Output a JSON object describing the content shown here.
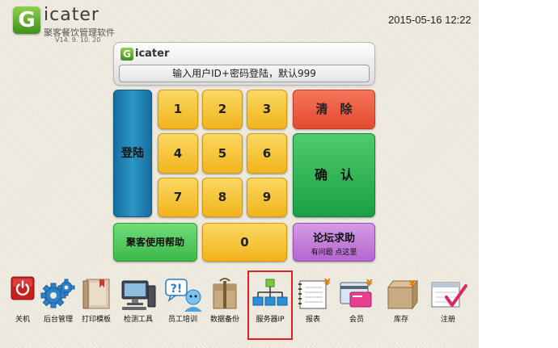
{
  "app": {
    "logo_letter": "G",
    "name": "icater",
    "subtitle": "聚客餐饮管理软件",
    "version": "V14. 9. 10. 20"
  },
  "datetime": "2015-05-16 12:22",
  "panel": {
    "brand_letter": "G",
    "brand_name": "icater",
    "prompt": "输入用户ID+密码登陆，默认999"
  },
  "keypad": {
    "login": "登陆",
    "keys": [
      "1",
      "2",
      "3",
      "4",
      "5",
      "6",
      "7",
      "8",
      "9",
      "0"
    ],
    "clear": "清　除",
    "confirm": "确　认",
    "help": "聚客使用帮助",
    "forum": "论坛求助",
    "forum_sub": "有问题 点这里"
  },
  "toolbar": [
    {
      "label": "关机",
      "icon": "power-icon"
    },
    {
      "label": "后台管理",
      "icon": "gears-icon"
    },
    {
      "label": "打印模板",
      "icon": "print-template-icon"
    },
    {
      "label": "检测工具",
      "icon": "computer-icon"
    },
    {
      "label": "员工培训",
      "icon": "help-bubble-icon"
    },
    {
      "label": "数据备份",
      "icon": "package-icon"
    },
    {
      "label": "服务器IP",
      "icon": "network-icon"
    },
    {
      "label": "报表",
      "icon": "ledger-icon"
    },
    {
      "label": "会员",
      "icon": "member-card-icon"
    },
    {
      "label": "库存",
      "icon": "inventory-box-icon"
    },
    {
      "label": "注册",
      "icon": "calendar-check-icon"
    }
  ],
  "colors": {
    "key": "#f5c12e",
    "login": "#1f81b3",
    "clear": "#ec5b3f",
    "confirm": "#2db556",
    "help": "#55c960",
    "forum": "#c47ed8",
    "highlight": "#e02020"
  }
}
